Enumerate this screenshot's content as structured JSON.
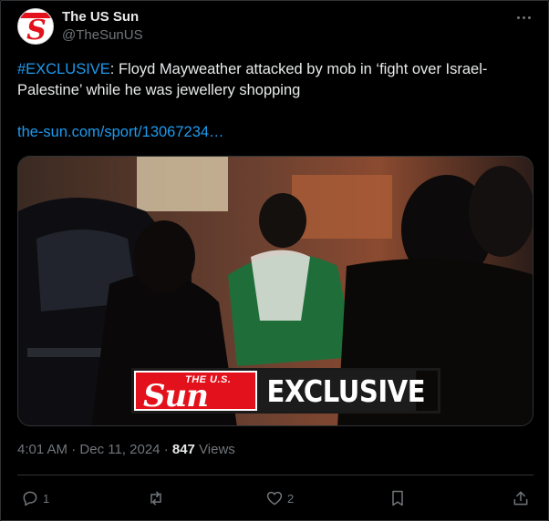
{
  "author": {
    "name": "The US Sun",
    "handle": "@TheSunUS"
  },
  "post": {
    "hashtag": "#EXCLUSIVE",
    "body": ": Floyd Mayweather attacked by mob in ‘fight over Israel-Palestine’ while he was jewellery shopping",
    "link": "the-sun.com/sport/13067234…",
    "media_overlay": {
      "logo_small": "THE U.S.",
      "logo_big": "Sun",
      "label": "EXCLUSIVE"
    }
  },
  "meta": {
    "time": "4:01 AM",
    "separator": "·",
    "date": "Dec 11, 2024",
    "views_count": "847",
    "views_label": "Views"
  },
  "actions": {
    "reply_count": "1",
    "repost_count": "",
    "like_count": "2"
  },
  "icons": {
    "more": "more-horizontal-icon",
    "reply": "reply-icon",
    "repost": "repost-icon",
    "like": "heart-icon",
    "bookmark": "bookmark-icon",
    "share": "share-icon"
  },
  "colors": {
    "background": "#000000",
    "text": "#e7e9ea",
    "muted": "#71767b",
    "link": "#1d9bf0",
    "brand_red": "#e3111b"
  }
}
